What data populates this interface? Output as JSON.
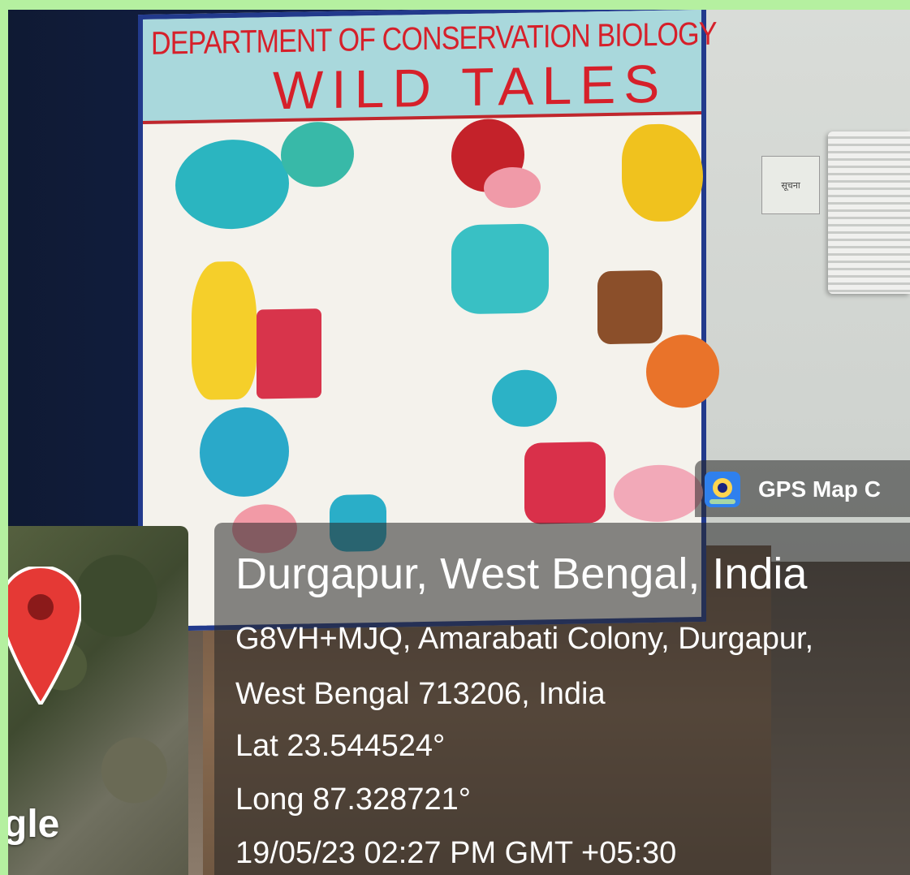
{
  "poster": {
    "department": "DEPARTMENT OF CONSERVATION BIOLOGY",
    "title": "WILD TALES"
  },
  "wall_sign": "सूचना",
  "overlay": {
    "app_name": "GPS Map C",
    "place": "Durgapur, West Bengal, India",
    "address_line1": "G8VH+MJQ, Amarabati Colony, Durgapur,",
    "address_line2": "West Bengal 713206, India",
    "lat": "Lat 23.544524°",
    "long": "Long 87.328721°",
    "timestamp": "19/05/23 02:27 PM GMT +05:30",
    "map_brand": "gle"
  },
  "colors": {
    "border_green": "#b5f0a0",
    "poster_red": "#d6202a",
    "pin_red": "#e53935"
  }
}
